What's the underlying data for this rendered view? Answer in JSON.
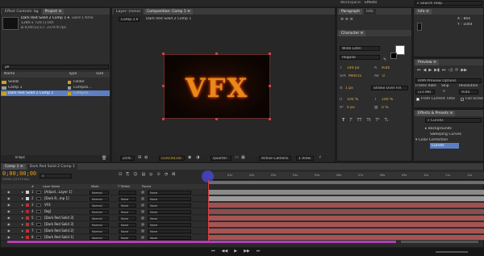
{
  "menubar": {
    "workspace_label": "Workspace:",
    "workspace_value": "Effects",
    "search_placeholder": "Search Help"
  },
  "project_panel": {
    "tabs": [
      "Effect Controls: bg",
      "Project ≡"
    ],
    "item_name": "Dark Red Solid 2 Comp 1 ▾",
    "item_used": ", used 1 time",
    "item_dims": "1280 x 720 (1.00)",
    "item_duration": "Δ 0;00;12;17, 23.976 fps",
    "search_placeholder": "ρ▾",
    "columns": [
      "Name",
      "Type",
      "Size"
    ],
    "rows": [
      {
        "name": "Solids",
        "type": "Folder",
        "color": "#c9a227",
        "selected": false
      },
      {
        "name": "Comp 1",
        "type": "Compos...",
        "color": "#9a9a9a",
        "selected": false
      },
      {
        "name": "Dark Red Solid 2 Comp 1",
        "type": "Compos...",
        "color": "#c9a227",
        "selected": true
      }
    ],
    "footer_bpc": "8 bpc"
  },
  "viewer": {
    "tabs": [
      "Layer: (none)",
      "Composition: Comp 1 ≡"
    ],
    "comp_dropdown": "Comp 1 ▾",
    "breadcrumb": "Dark Red Solid 2 Comp 1",
    "logo_text": "VFX",
    "zoom": "25%",
    "timecode": "0;00;00;00",
    "resolution": "Quarter",
    "camera": "Active Camera",
    "views": "1 View"
  },
  "paragraph_panel": {
    "tabs": [
      "Paragraph",
      "Info"
    ]
  },
  "character_panel": {
    "tab": "Character ≡",
    "font_family": "Wide Latin",
    "font_style": "Regular",
    "size": "140 px",
    "leading": "Auto",
    "kerning": "Metrics",
    "tracking": "0",
    "stroke_width": "1 px",
    "stroke_type": "Stroke Over Fill",
    "vscale": "100 %",
    "hscale": "100 %",
    "baseline": "0 px",
    "tsume": "0 %",
    "styles": [
      "T",
      "T",
      "TT",
      "Tt",
      "T¹",
      "T₁"
    ]
  },
  "info_panel": {
    "tab": "Info ≡",
    "x": "X : 864",
    "y": "Y : 1044"
  },
  "preview_panel": {
    "tab": "Preview ≡",
    "ram_options": "RAM Preview Options",
    "frame_rate_label": "Frame Rate",
    "skip_label": "Skip",
    "resolution_label": "Resolution",
    "frame_rate": "(23.98)",
    "skip": "0",
    "resolution": "Auto",
    "from_current": "From Current Time",
    "full_screen": "Full Scree"
  },
  "effects_panel": {
    "tab": "Effects & Presets ≡",
    "search_value": "Curves",
    "items": [
      {
        "label": "▸ Backgrounds",
        "indent": 2,
        "selected": false
      },
      {
        "label": "Sweeping Curves",
        "indent": 3,
        "selected": false
      },
      {
        "label": "▾ Color Correction",
        "indent": 0,
        "selected": false
      },
      {
        "label": "Curves",
        "indent": 3,
        "selected": true
      }
    ]
  },
  "timeline": {
    "tabs": [
      "Comp 1 ≡",
      "Dark Red Solid 2 Comp 1"
    ],
    "timecode": "0;00;00;00",
    "fps_info": "00000 (23.976 fps)",
    "ruler_ticks": [
      "01s",
      "02s",
      "03s",
      "04s",
      "05s",
      "06s",
      "07s",
      "08s",
      "09s",
      "10s",
      "11s",
      "12s"
    ],
    "columns": [
      "#",
      "Layer Name",
      "Mode",
      "T TrkMat",
      "Parent"
    ],
    "layers": [
      {
        "num": "1",
        "name": "[Adjust...Layer 1]",
        "mode": "Normal",
        "trkmat": "",
        "parent": "None",
        "color": "#d0d0d0",
        "bar": "#8a8a8a"
      },
      {
        "num": "2",
        "name": "[Dark R...mp 1]",
        "mode": "Normal",
        "trkmat": "None",
        "parent": "None",
        "color": "#d0d0d0",
        "bar": "#9a9a9a"
      },
      {
        "num": "3",
        "name": "VFX",
        "mode": "Normal",
        "trkmat": "None",
        "parent": "None",
        "color": "#c03030",
        "bar": "#a05050"
      },
      {
        "num": "4",
        "name": "[bg]",
        "mode": "Normal",
        "trkmat": "None",
        "parent": "None",
        "color": "#a03030",
        "bar": "#8f4c4c"
      },
      {
        "num": "5",
        "name": "[Dark Red Solid 3]",
        "mode": "Normal",
        "trkmat": "None",
        "parent": "None",
        "color": "#c03030",
        "bar": "#a65454"
      },
      {
        "num": "6",
        "name": "[Dark Red Solid 3]",
        "mode": "Normal",
        "trkmat": "None",
        "parent": "None",
        "color": "#c03030",
        "bar": "#a65454"
      },
      {
        "num": "7",
        "name": "[Dark Red Solid 2]",
        "mode": "Normal",
        "trkmat": "None",
        "parent": "None",
        "color": "#c03030",
        "bar": "#a65454"
      },
      {
        "num": "8",
        "name": "[Dark Red Solid 1]",
        "mode": "Normal",
        "trkmat": "None",
        "parent": "None",
        "color": "#c03030",
        "bar": "#a65454"
      }
    ]
  },
  "colors": {
    "accent": "#f0a000",
    "selection": "#5b7fc2",
    "playhead": "#4a4ae0",
    "work_area": "#b03fb0"
  }
}
